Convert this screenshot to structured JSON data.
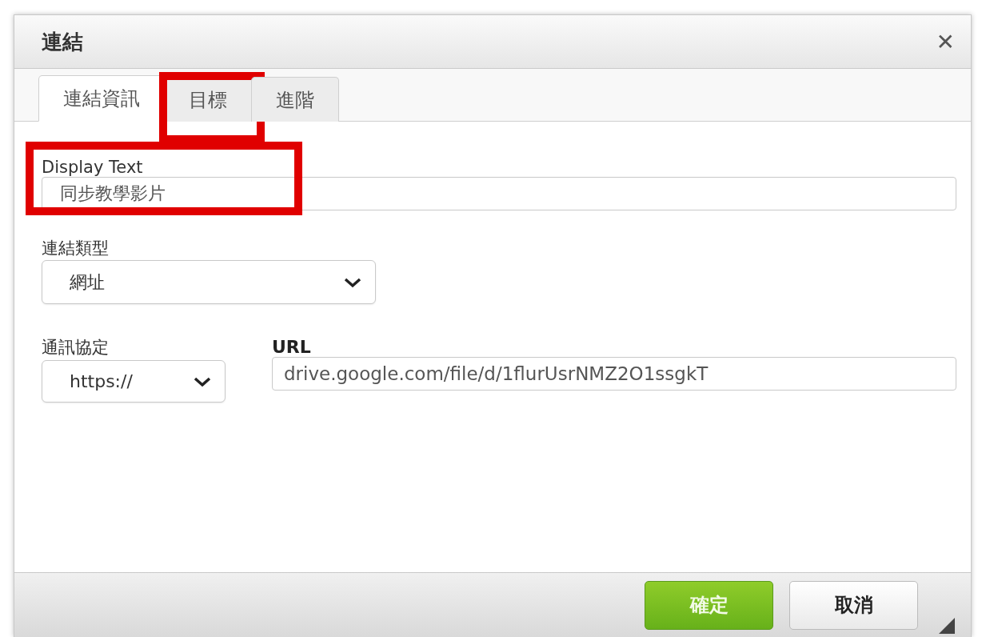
{
  "dialog": {
    "title": "連結",
    "close": "✕"
  },
  "tabs": [
    {
      "label": "連結資訊",
      "selected": true,
      "highlighted": false
    },
    {
      "label": "目標",
      "selected": false,
      "highlighted": true
    },
    {
      "label": "進階",
      "selected": false,
      "highlighted": false
    }
  ],
  "display_text": {
    "label": "Display Text",
    "value": "同步教學影片",
    "highlighted": true
  },
  "link_type": {
    "label": "連結類型",
    "value": "網址"
  },
  "protocol": {
    "label": "通訊協定",
    "value": "https://"
  },
  "url": {
    "label": "URL",
    "value": "drive.google.com/file/d/1flurUsrNMZ2O1ssgkT"
  },
  "buttons": [
    {
      "label": "確定",
      "kind": "primary"
    },
    {
      "label": "取消",
      "kind": "secondary"
    }
  ]
}
